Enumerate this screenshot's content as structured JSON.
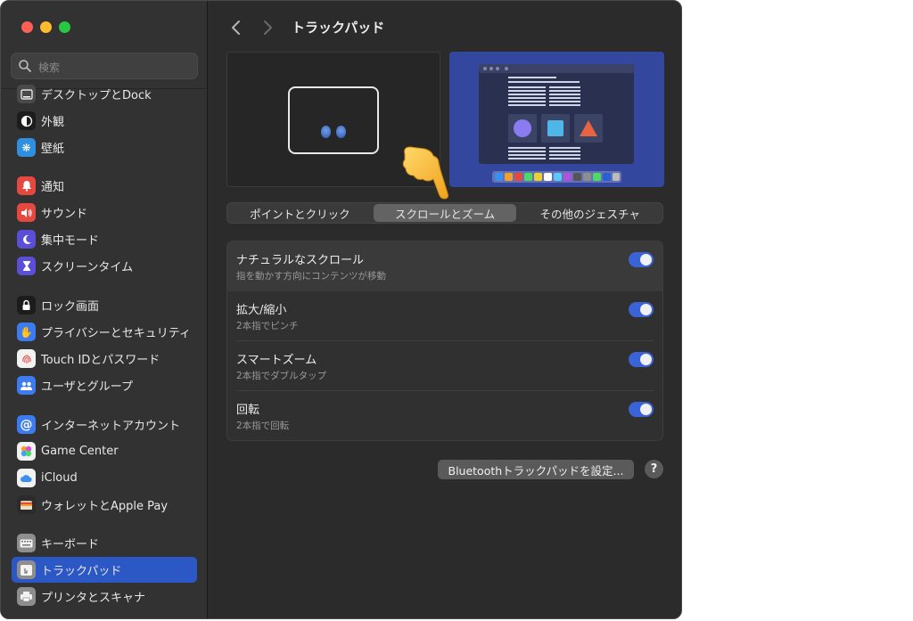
{
  "window": {
    "title": "トラックパッド"
  },
  "search": {
    "placeholder": "検索"
  },
  "sidebar": {
    "items": [
      {
        "label": "デスクトップとDock",
        "icon": "dock-icon",
        "color": "#4a4a4a"
      },
      {
        "label": "外観",
        "icon": "appearance-icon",
        "color": "#1c1c1c"
      },
      {
        "label": "壁紙",
        "icon": "wallpaper-icon",
        "color": "#2f8fe0"
      },
      {
        "label": "通知",
        "icon": "bell-icon",
        "color": "#e5483f"
      },
      {
        "label": "サウンド",
        "icon": "speaker-icon",
        "color": "#e5483f"
      },
      {
        "label": "集中モード",
        "icon": "moon-icon",
        "color": "#5a4fd6"
      },
      {
        "label": "スクリーンタイム",
        "icon": "hourglass-icon",
        "color": "#5a4fd6"
      },
      {
        "label": "ロック画面",
        "icon": "lock-icon",
        "color": "#1c1c1c"
      },
      {
        "label": "プライバシーとセキュリティ",
        "icon": "hand-icon",
        "color": "#3d7cf0"
      },
      {
        "label": "Touch IDとパスワード",
        "icon": "fingerprint-icon",
        "color": "#f2f2f2"
      },
      {
        "label": "ユーザとグループ",
        "icon": "users-icon",
        "color": "#3d7cf0"
      },
      {
        "label": "インターネットアカウント",
        "icon": "at-icon",
        "color": "#3d7cf0"
      },
      {
        "label": "Game Center",
        "icon": "game-center-icon",
        "color": "#f2f2f2"
      },
      {
        "label": "iCloud",
        "icon": "cloud-icon",
        "color": "#f2f2f2"
      },
      {
        "label": "ウォレットとApple Pay",
        "icon": "wallet-icon",
        "color": "#2b2b2b"
      },
      {
        "label": "キーボード",
        "icon": "keyboard-icon",
        "color": "#8e8e8e"
      },
      {
        "label": "トラックパッド",
        "icon": "trackpad-icon",
        "color": "#8e8e8e"
      },
      {
        "label": "プリンタとスキャナ",
        "icon": "printer-icon",
        "color": "#8e8e8e"
      }
    ]
  },
  "tabs": [
    {
      "label": "ポイントとクリック"
    },
    {
      "label": "スクロールとズーム"
    },
    {
      "label": "その他のジェスチャ"
    }
  ],
  "settings": [
    {
      "title": "ナチュラルなスクロール",
      "subtitle": "指を動かす方向にコンテンツが移動",
      "enabled": true
    },
    {
      "title": "拡大/縮小",
      "subtitle": "2本指でピンチ",
      "enabled": true
    },
    {
      "title": "スマートズーム",
      "subtitle": "2本指でダブルタップ",
      "enabled": true
    },
    {
      "title": "回転",
      "subtitle": "2本指で回転",
      "enabled": true
    }
  ],
  "buttons": {
    "bluetooth": "Bluetoothトラックパッドを設定...",
    "help": "?"
  },
  "colors": {
    "accent": "#2c58c6",
    "toggle_on": "#3a63d8"
  }
}
